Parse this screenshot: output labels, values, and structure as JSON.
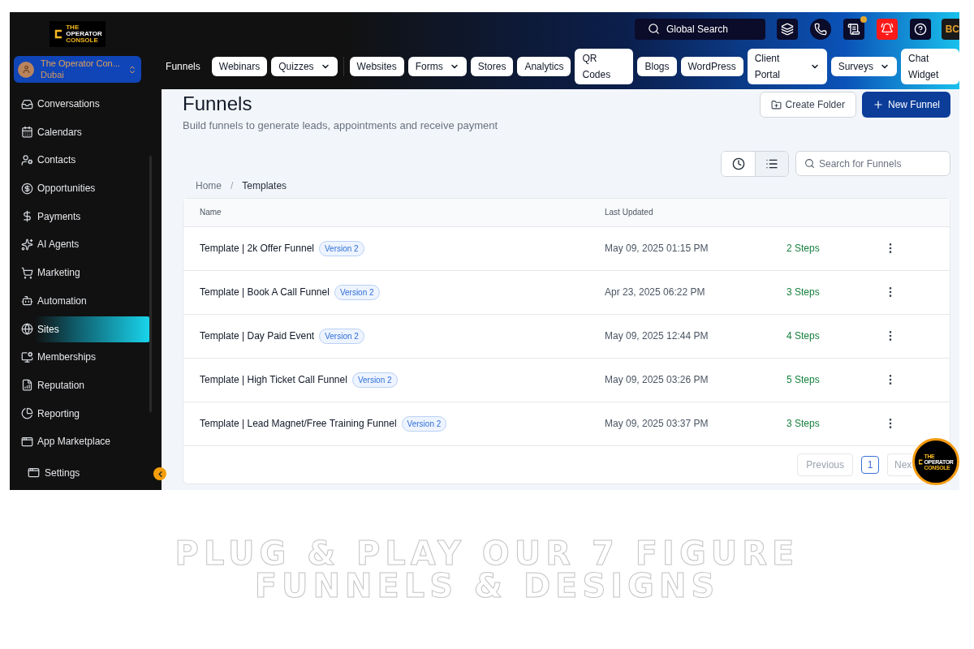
{
  "logo": {
    "lines": [
      "THE",
      "OPERATOR",
      "CONSOLE"
    ]
  },
  "chat_logo": {
    "lines": [
      "THE",
      "OPERATOR",
      "CONSOLE"
    ]
  },
  "account": {
    "name": "The Operator Con...",
    "location": "Dubai"
  },
  "top_search": {
    "placeholder": "Global Search"
  },
  "top_icons": [
    {
      "kind": "layers"
    },
    {
      "kind": "phone"
    },
    {
      "kind": "scroll",
      "badge": true
    },
    {
      "kind": "bell",
      "alert": true
    },
    {
      "kind": "help"
    }
  ],
  "user_initials": "BC",
  "nav_label": "Funnels",
  "nav_tabs": [
    {
      "label": "Webinars",
      "dropdown": false
    },
    {
      "label": "Quizzes",
      "dropdown": true
    },
    {
      "label": "Websites",
      "dropdown": false
    },
    {
      "label": "Forms",
      "dropdown": true
    },
    {
      "label": "Stores",
      "dropdown": false
    },
    {
      "label": "Analytics",
      "dropdown": false
    },
    {
      "label": "QR Codes",
      "dropdown": false
    },
    {
      "label": "Blogs",
      "dropdown": false
    },
    {
      "label": "WordPress",
      "dropdown": false
    },
    {
      "label": "Client Portal",
      "dropdown": true
    },
    {
      "label": "Surveys",
      "dropdown": true
    },
    {
      "label": "Chat Widget",
      "dropdown": false
    }
  ],
  "sidebar": {
    "items": [
      {
        "label": "Conversations",
        "selected": false
      },
      {
        "label": "Calendars",
        "selected": false
      },
      {
        "label": "Contacts",
        "selected": false
      },
      {
        "label": "Opportunities",
        "selected": false
      },
      {
        "label": "Payments",
        "selected": false
      },
      {
        "label": "AI Agents",
        "selected": false
      },
      {
        "label": "Marketing",
        "selected": false
      },
      {
        "label": "Automation",
        "selected": false
      },
      {
        "label": "Sites",
        "selected": true
      },
      {
        "label": "Memberships",
        "selected": false
      },
      {
        "label": "Reputation",
        "selected": false
      },
      {
        "label": "Reporting",
        "selected": false
      },
      {
        "label": "App Marketplace",
        "selected": false
      }
    ],
    "settings": "Settings"
  },
  "page": {
    "title": "Funnels",
    "subtitle": "Build funnels to generate leads, appointments and receive payment",
    "create_folder": "Create Folder",
    "new_funnel": "New Funnel"
  },
  "view_toggle": [
    {
      "kind": "clock",
      "selected": false
    },
    {
      "kind": "list",
      "selected": true
    }
  ],
  "search": {
    "placeholder": "Search for Funnels"
  },
  "breadcrumb": {
    "items": [
      "Home",
      "Templates"
    ],
    "separator": "/"
  },
  "table": {
    "columns": [
      "Name",
      "Last Updated"
    ],
    "rows": [
      {
        "name": "Template | 2k Offer Funnel",
        "badge": "Version 2",
        "updated": "May 09, 2025 01:15 PM",
        "steps": "2 Steps"
      },
      {
        "name": "Template | Book A Call Funnel",
        "badge": "Version 2",
        "updated": "Apr 23, 2025 06:22 PM",
        "steps": "3 Steps"
      },
      {
        "name": "Template | Day Paid Event",
        "badge": "Version 2",
        "updated": "May 09, 2025 12:44 PM",
        "steps": "4 Steps"
      },
      {
        "name": "Template | High Ticket Call Funnel",
        "badge": "Version 2",
        "updated": "May 09, 2025 03:26 PM",
        "steps": "5 Steps"
      },
      {
        "name": "Template | Lead Magnet/Free Training Funnel",
        "badge": "Version 2",
        "updated": "May 09, 2025 03:37 PM",
        "steps": "3 Steps"
      }
    ]
  },
  "pagination": {
    "previous": "Previous",
    "pages": [
      {
        "label": "1",
        "selected": true
      }
    ],
    "next": "Nex"
  },
  "headline": [
    "PLUG & PLAY OUR 7 FIGURE",
    "FUNNELS & DESIGNS"
  ]
}
